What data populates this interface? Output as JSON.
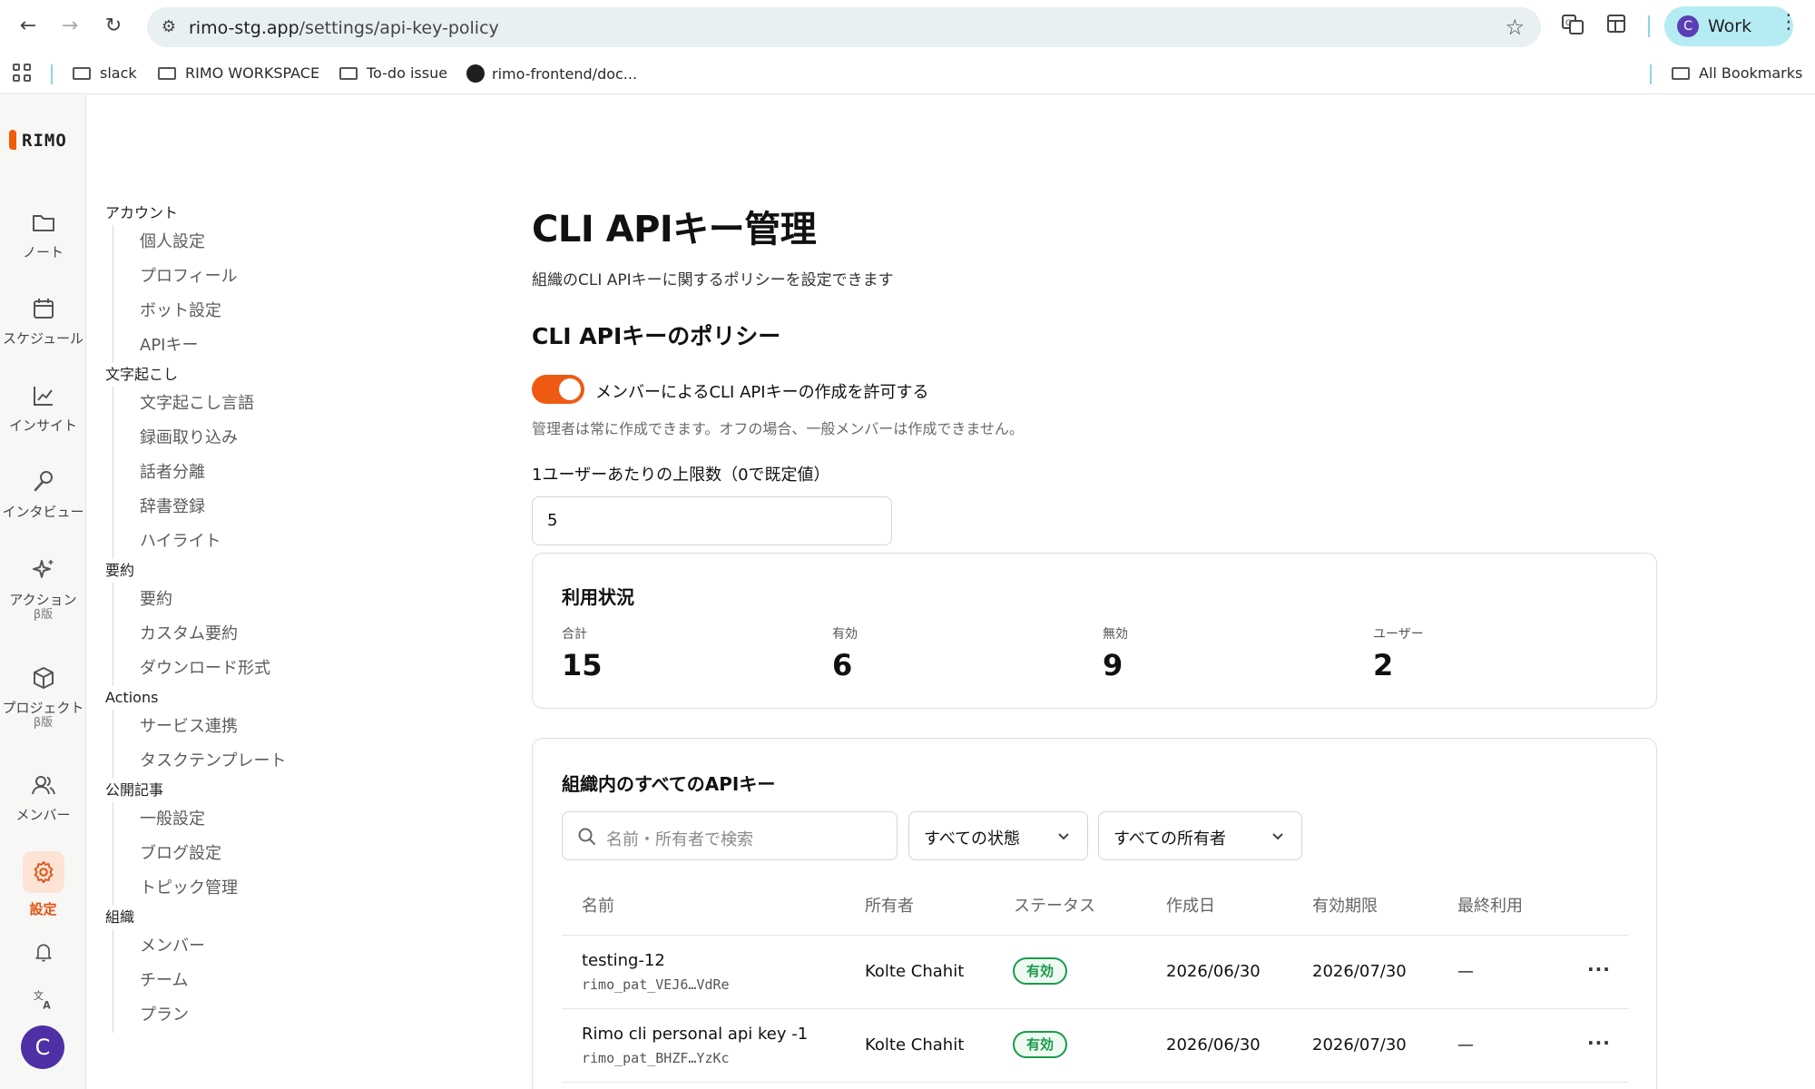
{
  "browser": {
    "url_host": "rimo-stg.app",
    "url_path": "/settings/api-key-policy",
    "profile_initial": "C",
    "profile_label": "Work",
    "bookmarks": [
      "slack",
      "RIMO WORKSPACE",
      "To-do issue",
      "rimo-frontend/doc...",
      "All Bookmarks"
    ]
  },
  "app": {
    "logo_text": "RIMO",
    "rail": [
      {
        "label": "ノート",
        "icon": "folder-icon"
      },
      {
        "label": "スケジュール",
        "icon": "calendar-icon"
      },
      {
        "label": "インサイト",
        "icon": "chart-icon"
      },
      {
        "label": "インタビュー",
        "icon": "microphone-icon"
      },
      {
        "label": "アクション",
        "sub": "β版",
        "icon": "sparkle-icon"
      },
      {
        "label": "プロジェクト",
        "sub": "β版",
        "icon": "package-icon"
      },
      {
        "label": "メンバー",
        "icon": "users-icon"
      },
      {
        "label": "設定",
        "icon": "gear-icon"
      }
    ],
    "avatar_initial": "C"
  },
  "settings_nav": {
    "groups": [
      {
        "title": "アカウント",
        "items": [
          "個人設定",
          "プロフィール",
          "ボット設定",
          "APIキー"
        ]
      },
      {
        "title": "文字起こし",
        "items": [
          "文字起こし言語",
          "録画取り込み",
          "話者分離",
          "辞書登録",
          "ハイライト"
        ]
      },
      {
        "title": "要約",
        "items": [
          "要約",
          "カスタム要約",
          "ダウンロード形式"
        ]
      },
      {
        "title": "Actions",
        "items": [
          "サービス連携",
          "タスクテンプレート"
        ]
      },
      {
        "title": "公開記事",
        "items": [
          "一般設定",
          "ブログ設定",
          "トピック管理"
        ]
      },
      {
        "title": "組織",
        "items": [
          "メンバー",
          "チーム",
          "プラン"
        ]
      }
    ]
  },
  "page": {
    "title": "CLI APIキー管理",
    "description": "組織のCLI APIキーに関するポリシーを設定できます",
    "policy_heading": "CLI APIキーのポリシー",
    "toggle_label": "メンバーによるCLI APIキーの作成を許可する",
    "toggle_on": true,
    "toggle_hint": "管理者は常に作成できます。オフの場合、一般メンバーは作成できません。",
    "limit_label": "1ユーザーあたりの上限数（0で既定値）",
    "limit_value": "5"
  },
  "usage": {
    "heading": "利用状況",
    "stats": [
      {
        "label": "合計",
        "value": "15"
      },
      {
        "label": "有効",
        "value": "6"
      },
      {
        "label": "無効",
        "value": "9"
      },
      {
        "label": "ユーザー",
        "value": "2"
      }
    ]
  },
  "keys": {
    "heading": "組織内のすべてのAPIキー",
    "search_placeholder": "名前・所有者で検索",
    "status_filter": "すべての状態",
    "owner_filter": "すべての所有者",
    "columns": [
      "名前",
      "所有者",
      "ステータス",
      "作成日",
      "有効期限",
      "最終利用"
    ],
    "rows": [
      {
        "name": "testing-12",
        "id": "rimo_pat_VEJ6…VdRe",
        "owner": "Kolte Chahit",
        "status": "有効",
        "created": "2026/06/30",
        "expires": "2026/07/30",
        "last_used": "—"
      },
      {
        "name": "Rimo cli personal api key -1",
        "id": "rimo_pat_BHZF…YzKc",
        "owner": "Kolte Chahit",
        "status": "有効",
        "created": "2026/06/30",
        "expires": "2026/07/30",
        "last_used": "—"
      }
    ]
  },
  "colors": {
    "accent": "#ef5a13",
    "badge_green": "#1a9a4b",
    "profile_bg": "#b5ecf3"
  }
}
